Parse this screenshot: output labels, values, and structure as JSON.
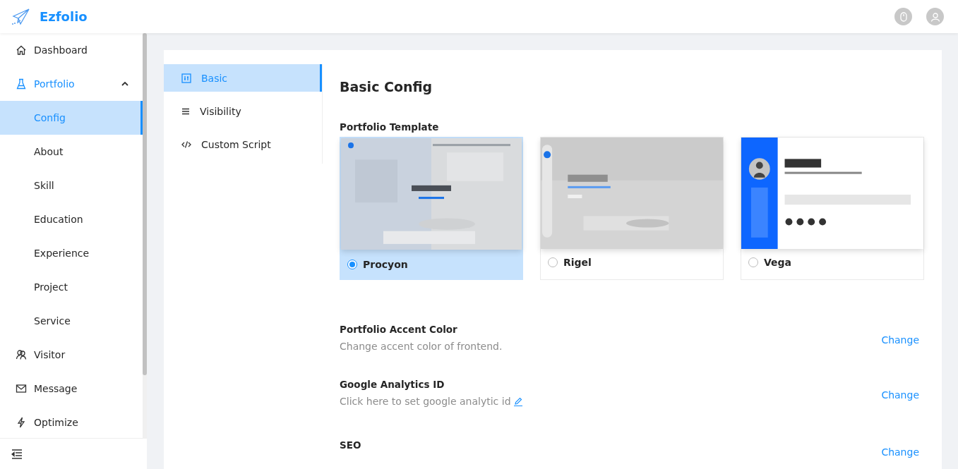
{
  "header": {
    "brand": "Ezfolio"
  },
  "sidebar": {
    "items": [
      {
        "label": "Dashboard",
        "selected": false
      },
      {
        "label": "Portfolio",
        "selected": true,
        "expanded": true,
        "children": [
          {
            "label": "Config",
            "selected": true
          },
          {
            "label": "About",
            "selected": false
          },
          {
            "label": "Skill",
            "selected": false
          },
          {
            "label": "Education",
            "selected": false
          },
          {
            "label": "Experience",
            "selected": false
          },
          {
            "label": "Project",
            "selected": false
          },
          {
            "label": "Service",
            "selected": false
          }
        ]
      },
      {
        "label": "Visitor",
        "selected": false
      },
      {
        "label": "Message",
        "selected": false
      },
      {
        "label": "Optimize",
        "selected": false
      }
    ]
  },
  "config_tabs": [
    {
      "label": "Basic",
      "selected": true
    },
    {
      "label": "Visibility",
      "selected": false
    },
    {
      "label": "Custom Script",
      "selected": false
    }
  ],
  "section_title": "Basic Config",
  "template_label": "Portfolio Template",
  "templates": [
    {
      "name": "Procyon",
      "kind": "picture",
      "selected": true
    },
    {
      "name": "Rigel",
      "kind": "picture",
      "selected": false
    },
    {
      "name": "Vega",
      "kind": "picture",
      "selected": false
    }
  ],
  "settings": [
    {
      "title": "Portfolio Accent Color",
      "description": "Change accent color of frontend.",
      "editable": false,
      "action": "Change"
    },
    {
      "title": "Google Analytics ID",
      "description": "Click here to set google analytic id",
      "editable": true,
      "action": "Change"
    },
    {
      "title": "SEO",
      "action": "Change"
    }
  ]
}
